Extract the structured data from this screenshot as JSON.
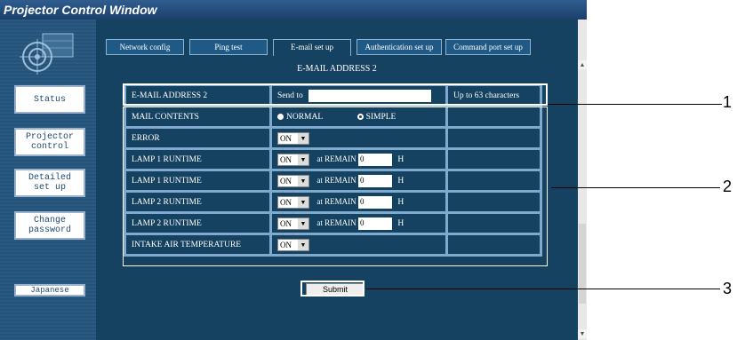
{
  "window": {
    "title": "Projector Control Window"
  },
  "sidebar": {
    "buttons": [
      {
        "label": "Status"
      },
      {
        "label": "Projector\ncontrol"
      },
      {
        "label": "Detailed\nset up"
      },
      {
        "label": "Change\npassword"
      },
      {
        "label": "Japanese"
      }
    ]
  },
  "tabs": [
    {
      "label": "Network config"
    },
    {
      "label": "Ping test"
    },
    {
      "label": "E-mail set up"
    },
    {
      "label": "Authentication set up"
    },
    {
      "label": "Command port set up"
    }
  ],
  "page_title": "E-MAIL ADDRESS 2",
  "email_row": {
    "label": "E-MAIL ADDRESS 2",
    "send_to": "Send to",
    "value": "",
    "hint": "Up to 63 characters"
  },
  "mail_contents": {
    "label": "MAIL CONTENTS",
    "opt1": "NORMAL",
    "opt2": "SIMPLE",
    "selected": "SIMPLE"
  },
  "rows": [
    {
      "label": "ERROR",
      "select": "ON"
    },
    {
      "label": "LAMP 1 RUNTIME",
      "select": "ON",
      "remain_label": "at REMAIN",
      "remain_value": "0",
      "unit": "H"
    },
    {
      "label": "LAMP 1 RUNTIME",
      "select": "ON",
      "remain_label": "at REMAIN",
      "remain_value": "0",
      "unit": "H"
    },
    {
      "label": "LAMP 2 RUNTIME",
      "select": "ON",
      "remain_label": "at REMAIN",
      "remain_value": "0",
      "unit": "H"
    },
    {
      "label": "LAMP 2 RUNTIME",
      "select": "ON",
      "remain_label": "at REMAIN",
      "remain_value": "0",
      "unit": "H"
    },
    {
      "label": "INTAKE AIR TEMPERATURE",
      "select": "ON"
    }
  ],
  "submit_label": "Submit",
  "callouts": [
    "1",
    "2",
    "3"
  ]
}
